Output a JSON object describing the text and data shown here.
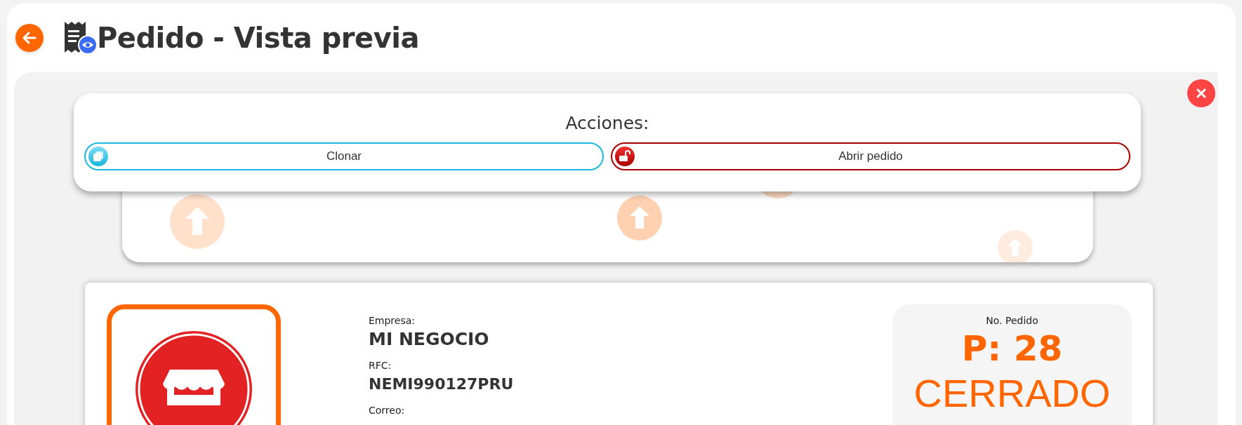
{
  "header": {
    "title": "Pedido - Vista previa"
  },
  "actions": {
    "title": "Acciones:",
    "buttons": [
      {
        "label": "Clonar",
        "kind": "clone"
      },
      {
        "label": "Abrir pedido",
        "kind": "open"
      }
    ]
  },
  "company": {
    "fields": [
      {
        "label": "Empresa:",
        "value": "MI NEGOCIO"
      },
      {
        "label": "RFC:",
        "value": "NEMI990127PRU"
      },
      {
        "label": "Correo:"
      }
    ]
  },
  "order": {
    "label": "No. Pedido",
    "number": "P: 28",
    "status": "CERRADO"
  }
}
